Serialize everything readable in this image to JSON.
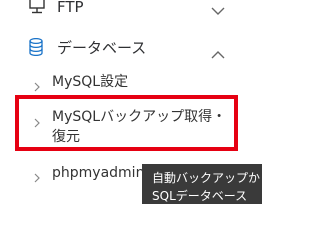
{
  "menu": {
    "ftp": {
      "label": "FTP",
      "icon": "monitor-icon",
      "chevron": "chevron-down-icon"
    },
    "database": {
      "label": "データベース",
      "icon": "database-icon",
      "chevron": "chevron-up-icon",
      "accent_color": "#1a73c8"
    },
    "submenu": [
      {
        "label": "MySQL設定"
      },
      {
        "label": "MySQLバックアップ取得・復元"
      },
      {
        "label": "phpmyadmin(MySQL5.7)"
      }
    ]
  },
  "tooltip": {
    "line1": "自動バックアップか",
    "line2": "SQLデータベース"
  },
  "highlight_color": "#e60012"
}
